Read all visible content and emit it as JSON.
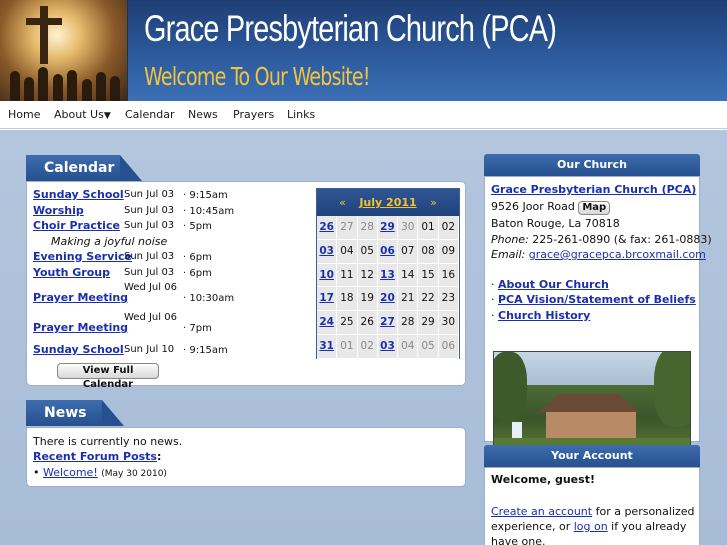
{
  "header": {
    "title": "Grace Presbyterian Church (PCA)",
    "subtitle": "Welcome To Our Website!"
  },
  "nav": {
    "home": "Home",
    "about": "About Us",
    "about_arrow": "▼",
    "calendar": "Calendar",
    "news": "News",
    "prayers": "Prayers",
    "links": "Links"
  },
  "calendar": {
    "title": "Calendar",
    "events": [
      {
        "name": "Sunday School",
        "date": "Sun Jul 03",
        "time": "9:15am"
      },
      {
        "name": "Worship",
        "date": "Sun Jul 03",
        "time": "10:45am"
      },
      {
        "name": "Choir Practice",
        "date": "Sun Jul 03",
        "time": "5pm",
        "note": "Making a joyful noise"
      },
      {
        "name": "Evening Service",
        "date": "Sun Jul 03",
        "time": "6pm"
      },
      {
        "name": "Youth Group",
        "date": "Sun Jul 03",
        "time": "6pm"
      },
      {
        "name": "Prayer Meeting",
        "date": "Wed Jul 06",
        "time": "10:30am"
      },
      {
        "name": "Prayer Meeting",
        "date": "Wed Jul 06",
        "time": "7pm"
      },
      {
        "name": "Sunday School",
        "date": "Sun Jul 10",
        "time": "9:15am"
      }
    ],
    "separator": "·",
    "view_full": "View Full Calendar",
    "mini": {
      "prev": "«",
      "month": "July 2011",
      "next": "»",
      "rows": [
        [
          "26",
          "27",
          "28",
          "29",
          "30",
          "01",
          "02"
        ],
        [
          "03",
          "04",
          "05",
          "06",
          "07",
          "08",
          "09"
        ],
        [
          "10",
          "11",
          "12",
          "13",
          "14",
          "15",
          "16"
        ],
        [
          "17",
          "18",
          "19",
          "20",
          "21",
          "22",
          "23"
        ],
        [
          "24",
          "25",
          "26",
          "27",
          "28",
          "29",
          "30"
        ],
        [
          "31",
          "01",
          "02",
          "03",
          "04",
          "05",
          "06"
        ]
      ]
    }
  },
  "news": {
    "title": "News",
    "empty": "There is currently no news.",
    "recent_label": "Recent Forum Posts",
    "recent_colon": ":",
    "bullet": "•",
    "post_title": "Welcome!",
    "post_date": "(May 30 2010)"
  },
  "church": {
    "title": "Our Church",
    "name": "Grace Presbyterian Church (PCA)",
    "street": "9526 Joor Road",
    "map_button": "Map",
    "city": "Baton Rouge, La 70818",
    "phone_label": "Phone:",
    "phone": "225-261-0890 (& fax: 261-0883)",
    "email_label": "Email:",
    "email": "grace@gracepca.brcoxmail.com",
    "link_bullet": "·",
    "links": [
      "About Our Church",
      "PCA Vision/Statement of Beliefs",
      "Church History"
    ]
  },
  "account": {
    "title": "Your Account",
    "welcome": "Welcome, guest!",
    "create_link": "Create an account",
    "text1": " for a personalized experience, or ",
    "logon_link": "log on",
    "text2": " if you already have one."
  }
}
